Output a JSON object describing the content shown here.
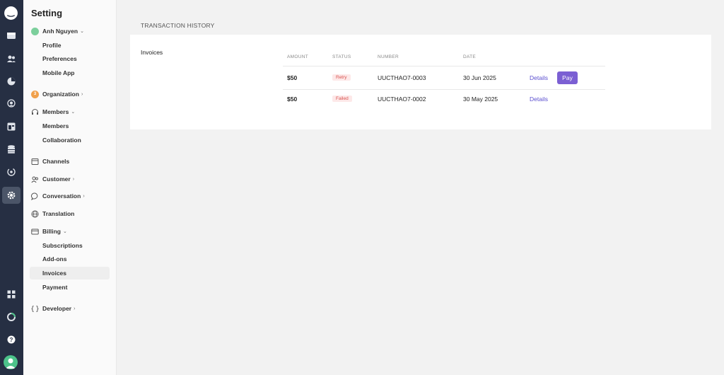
{
  "sidebar": {
    "title": "Setting",
    "user": {
      "name": "Anh Nguyen",
      "items": [
        "Profile",
        "Preferences",
        "Mobile App"
      ]
    },
    "organization": {
      "label": "Organization",
      "badge": "3"
    },
    "members": {
      "label": "Members",
      "items": [
        "Members",
        "Collaboration"
      ]
    },
    "channels": "Channels",
    "customer": "Customer",
    "conversation": "Conversation",
    "translation": "Translation",
    "billing": {
      "label": "Billing",
      "items": [
        "Subscriptions",
        "Add-ons",
        "Invoices",
        "Payment"
      ],
      "active": "Invoices"
    },
    "developer": "Developer"
  },
  "main": {
    "section_title": "TRANSACTION HISTORY",
    "card_label": "Invoices",
    "columns": [
      "AMOUNT",
      "STATUS",
      "NUMBER",
      "DATE"
    ],
    "rows": [
      {
        "amount": "$50",
        "status": "Retry",
        "number": "UUCTHAO7-0003",
        "date": "30 Jun 2025",
        "details": "Details",
        "action": "Pay"
      },
      {
        "amount": "$50",
        "status": "Failed",
        "number": "UUCTHAO7-0002",
        "date": "30 May 2025",
        "details": "Details"
      }
    ]
  },
  "colors": {
    "rail": "#262f43",
    "accent": "#7b5fd3",
    "link": "#5b4fcf",
    "danger": "#d9534f"
  }
}
